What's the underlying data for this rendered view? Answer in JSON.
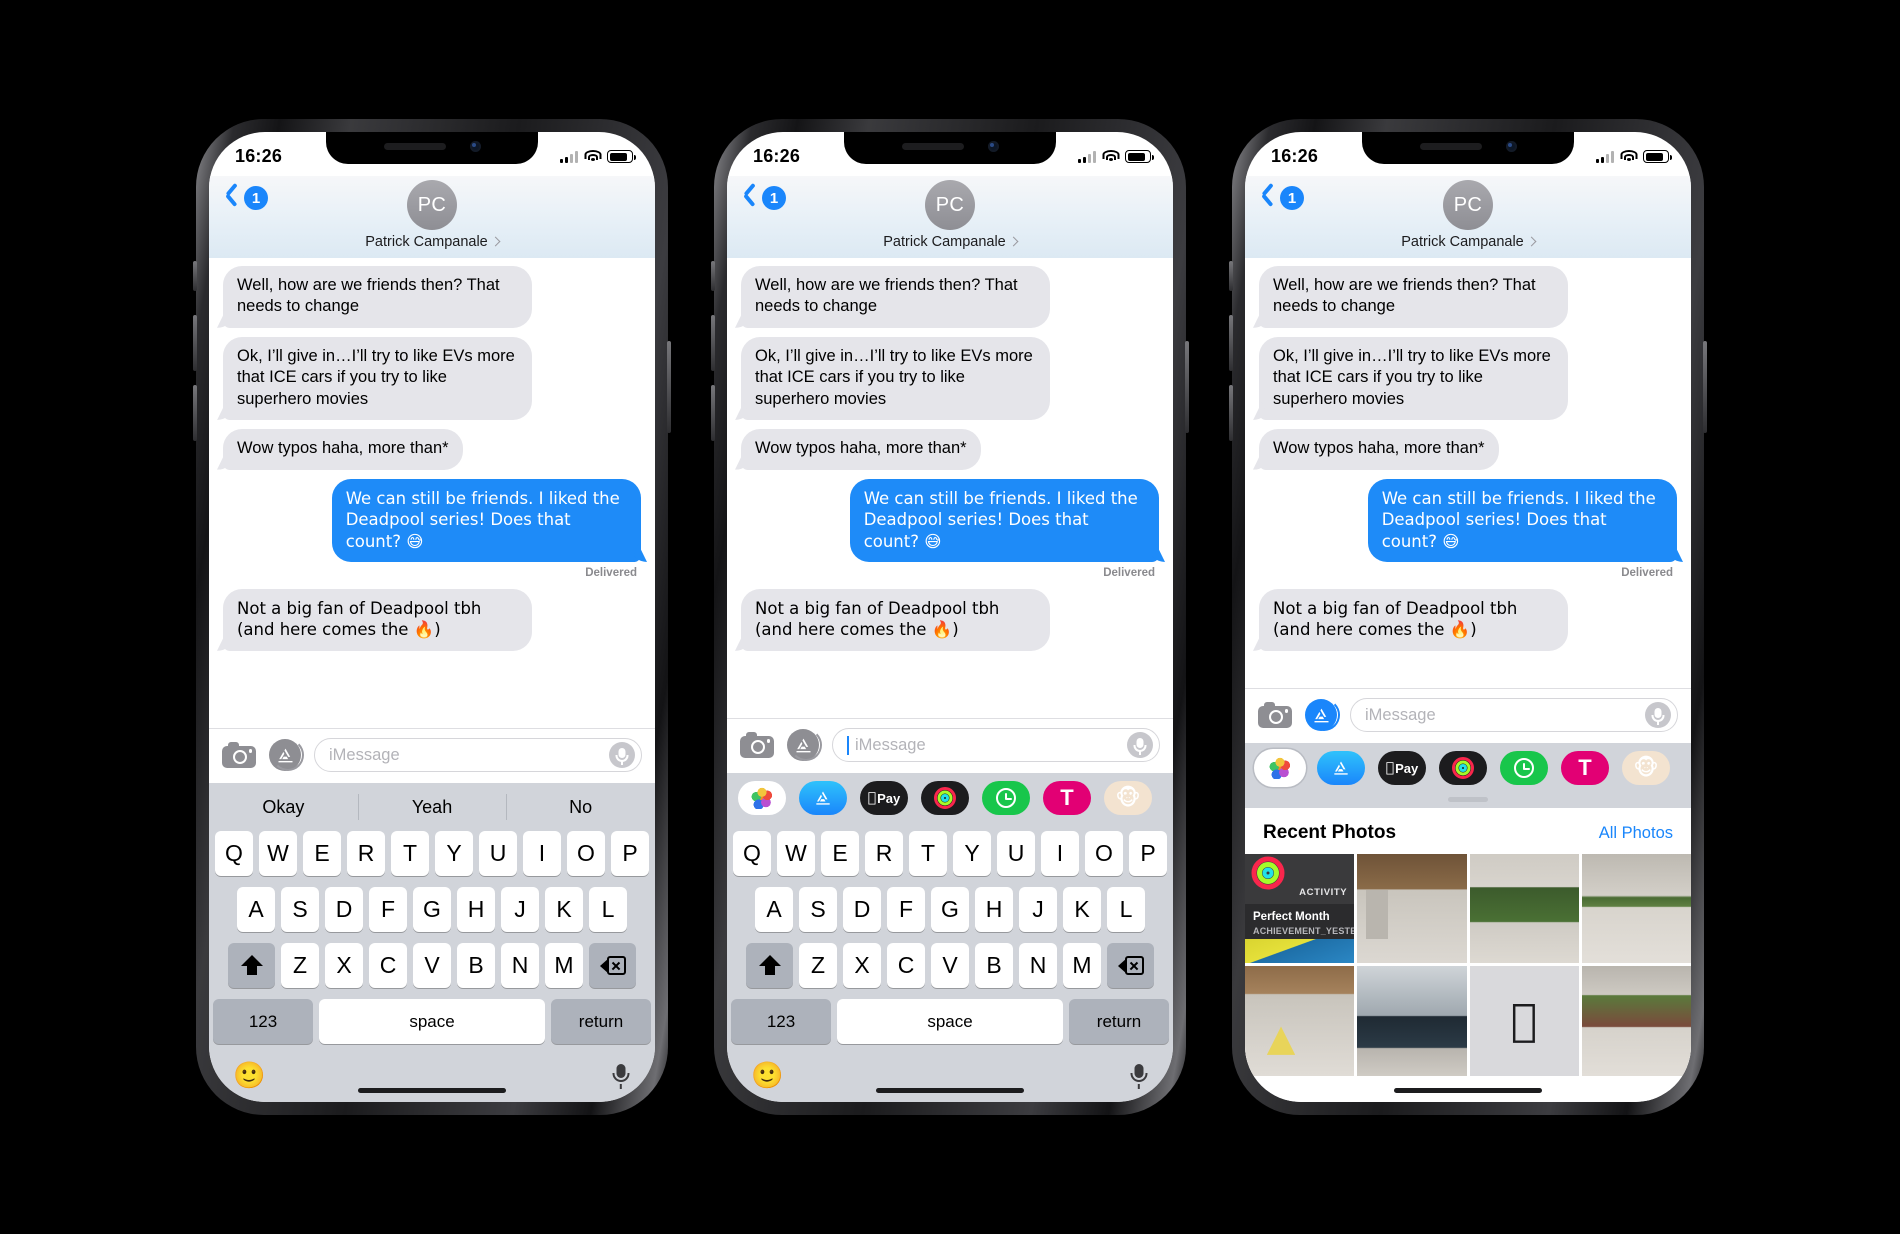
{
  "app": {
    "name": "Messages",
    "platform": "iOS"
  },
  "status_bar": {
    "time": "16:26",
    "signal_icon": "cellular-bars-icon",
    "wifi_icon": "wifi-icon",
    "battery_icon": "battery-icon"
  },
  "nav": {
    "back_icon": "chevron-left-icon",
    "unread_badge": "1",
    "avatar_initials": "PC",
    "contact_name": "Patrick Campanale",
    "disclosure_icon": "chevron-right-icon"
  },
  "conversation": {
    "messages": [
      {
        "side": "in",
        "text": "Well, how are we friends then? That needs to change"
      },
      {
        "side": "in",
        "text": "Ok, I’ll give in…I’ll try to like EVs more that ICE cars if you try to like superhero movies"
      },
      {
        "side": "in",
        "text": "Wow typos haha, more than*"
      },
      {
        "side": "out",
        "text": "We can still be friends. I liked the Deadpool series! Does that count? 😅"
      },
      {
        "side": "in",
        "text": "Not a big fan of Deadpool tbh (and here comes the 🔥)"
      }
    ],
    "delivered_label": "Delivered"
  },
  "input_bar": {
    "camera_icon": "camera-icon",
    "appstore_icon": "app-store-icon",
    "placeholder": "iMessage",
    "mic_icon": "microphone-icon"
  },
  "quicktype": {
    "suggestions": [
      "Okay",
      "Yeah",
      "No"
    ]
  },
  "app_drawer": {
    "handle": "drawer-handle",
    "apps": [
      {
        "name": "Photos",
        "icon": "photos-icon",
        "label": ""
      },
      {
        "name": "App Store",
        "icon": "app-store-icon",
        "label": ""
      },
      {
        "name": "Apple Pay",
        "icon": "apple-pay-icon",
        "label": "Pay"
      },
      {
        "name": "Activity",
        "icon": "activity-rings-icon",
        "label": ""
      },
      {
        "name": "Clock App",
        "icon": "green-clock-icon",
        "label": ""
      },
      {
        "name": "T-Mobile",
        "icon": "t-mobile-icon",
        "label": "T"
      },
      {
        "name": "Memoji",
        "icon": "monkey-memoji-icon",
        "label": "🐵"
      }
    ]
  },
  "keyboard": {
    "row1": [
      "Q",
      "W",
      "E",
      "R",
      "T",
      "Y",
      "U",
      "I",
      "O",
      "P"
    ],
    "row2": [
      "A",
      "S",
      "D",
      "F",
      "G",
      "H",
      "J",
      "K",
      "L"
    ],
    "row3": [
      "Z",
      "X",
      "C",
      "V",
      "B",
      "N",
      "M"
    ],
    "shift_icon": "shift-arrow-icon",
    "delete_icon": "backspace-icon",
    "numbers_label": "123",
    "space_label": "space",
    "return_label": "return",
    "emoji_key": "🙂",
    "dictation_icon": "microphone-icon"
  },
  "photos_panel": {
    "title": "Recent Photos",
    "all_photos_label": "All Photos",
    "tiles": [
      {
        "kind": "activity",
        "badge": "ACTIVITY",
        "title": "Perfect Month",
        "subtitle": "ACHIEVEMENT_YESTERDAY_DESC"
      },
      {
        "kind": "atrium",
        "alt": "Apple store interior with wooden ceiling"
      },
      {
        "kind": "garden",
        "alt": "Indoor garden planter"
      },
      {
        "kind": "walk",
        "alt": "Paved walkway with greenery"
      },
      {
        "kind": "store",
        "alt": "Apple store exterior with yellow canopy"
      },
      {
        "kind": "glass",
        "alt": "Dark glass storefront"
      },
      {
        "kind": "apple",
        "alt": "Apple logo on building wall",
        "glyph": ""
      },
      {
        "kind": "trees",
        "alt": "Trees outside building"
      }
    ]
  },
  "home_indicator": "home-indicator"
}
